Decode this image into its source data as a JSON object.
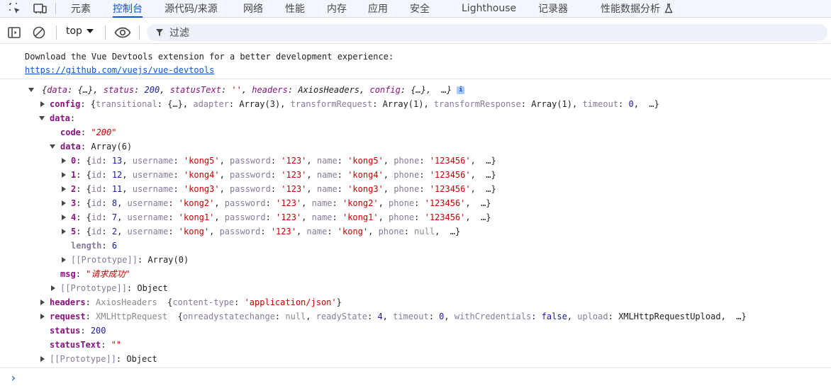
{
  "devtools": {
    "tabs": [
      "元素",
      "控制台",
      "源代码/来源",
      "网络",
      "性能",
      "内存",
      "应用",
      "安全",
      "Lighthouse",
      "记录器",
      "性能数据分析"
    ],
    "active_tab": "控制台"
  },
  "toolbar": {
    "context": "top",
    "filter_placeholder": "过滤"
  },
  "console": {
    "message_line1": "Download the Vue Devtools extension for a better development experience:",
    "message_link": "https://github.com/vuejs/vue-devtools",
    "summary": {
      "open": "{",
      "data_key": "data",
      "data_val": "{…}",
      "status_key": "status",
      "status_val": "200",
      "statusText_key": "statusText",
      "statusText_val": "''",
      "headers_key": "headers",
      "headers_val": "AxiosHeaders",
      "config_key": "config",
      "config_val": "{…}",
      "ellipsis": "…}",
      "info": "i"
    },
    "config_line": {
      "key": "config",
      "t_key": "transitional",
      "t_val": "{…}",
      "a_key": "adapter",
      "a_val": "Array(3)",
      "tr_key": "transformRequest",
      "tr_val": "Array(1)",
      "trs_key": "transformResponse",
      "trs_val": "Array(1)",
      "to_key": "timeout",
      "to_val": "0",
      "ellipsis": "…}"
    },
    "data_key": "data",
    "code_key": "code",
    "code_val": "\"200\"",
    "inner_data_key": "data",
    "inner_data_val": "Array(6)",
    "users": [
      {
        "idx": "0",
        "id": "13",
        "username": "'kong5'",
        "password": "'123'",
        "name": "'kong5'",
        "phone": "'123456'"
      },
      {
        "idx": "1",
        "id": "12",
        "username": "'kong4'",
        "password": "'123'",
        "name": "'kong4'",
        "phone": "'123456'"
      },
      {
        "idx": "2",
        "id": "11",
        "username": "'kong3'",
        "password": "'123'",
        "name": "'kong3'",
        "phone": "'123456'"
      },
      {
        "idx": "3",
        "id": "8",
        "username": "'kong2'",
        "password": "'123'",
        "name": "'kong2'",
        "phone": "'123456'"
      },
      {
        "idx": "4",
        "id": "7",
        "username": "'kong1'",
        "password": "'123'",
        "name": "'kong1'",
        "phone": "'123456'"
      },
      {
        "idx": "5",
        "id": "2",
        "username": "'kong'",
        "password": "'123'",
        "name": "'kong'",
        "phone": "null"
      }
    ],
    "length_key": "length",
    "length_val": "6",
    "proto_key": "[[Prototype]]",
    "proto_array": "Array(0)",
    "msg_key": "msg",
    "msg_val": "\"请求成功\"",
    "proto_object": "Object",
    "headers_line": {
      "key": "headers",
      "type": "AxiosHeaders",
      "ct_key": "content-type",
      "ct_val": "'application/json'"
    },
    "request_line": {
      "key": "request",
      "type": "XMLHttpRequest",
      "orsc_key": "onreadystatechange",
      "orsc_val": "null",
      "rs_key": "readyState",
      "rs_val": "4",
      "to_key": "timeout",
      "to_val": "0",
      "wc_key": "withCredentials",
      "wc_val": "false",
      "up_key": "upload",
      "up_val": "XMLHttpRequestUpload",
      "ellipsis": "…}"
    },
    "status_key": "status",
    "status_val": "200",
    "statusText_key": "statusText",
    "statusText_val": "\"\"",
    "prompt": "›"
  }
}
